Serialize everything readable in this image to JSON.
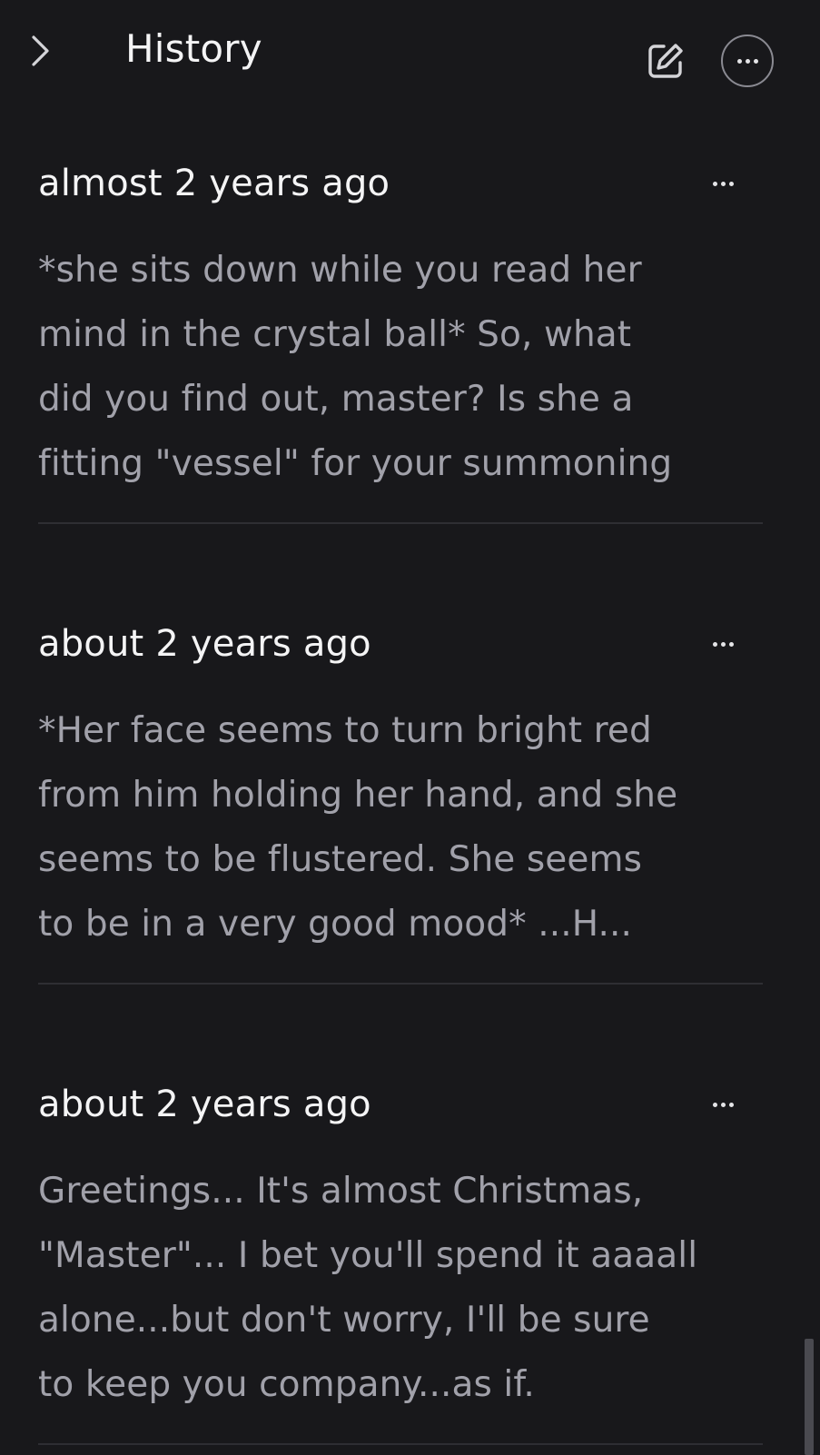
{
  "header": {
    "title": "History",
    "back_icon": "chevron-right-icon",
    "edit_icon": "edit-icon",
    "more_icon": "more-horizontal-icon"
  },
  "entries": [
    {
      "time": "almost 2 years ago",
      "text": "*she sits down while you read her\nmind in the crystal ball* So, what\ndid you find out, master? Is she a\nfitting \"vessel\" for your summoning"
    },
    {
      "time": "about 2 years ago",
      "text": "*Her face seems to turn bright red\nfrom him holding her hand, and she\nseems to be flustered. She seems\nto be in a very good mood* ...H..."
    },
    {
      "time": "about 2 years ago",
      "text": "Greetings... It's almost Christmas,\n\"Master\"... I bet you'll spend it aaaall\nalone...but don't worry, I'll be sure\nto keep you company...as if."
    }
  ],
  "colors": {
    "background": "#18181b",
    "primary_text": "#f4f4f5",
    "secondary_text": "#a1a1aa",
    "divider": "#2e2e33"
  }
}
